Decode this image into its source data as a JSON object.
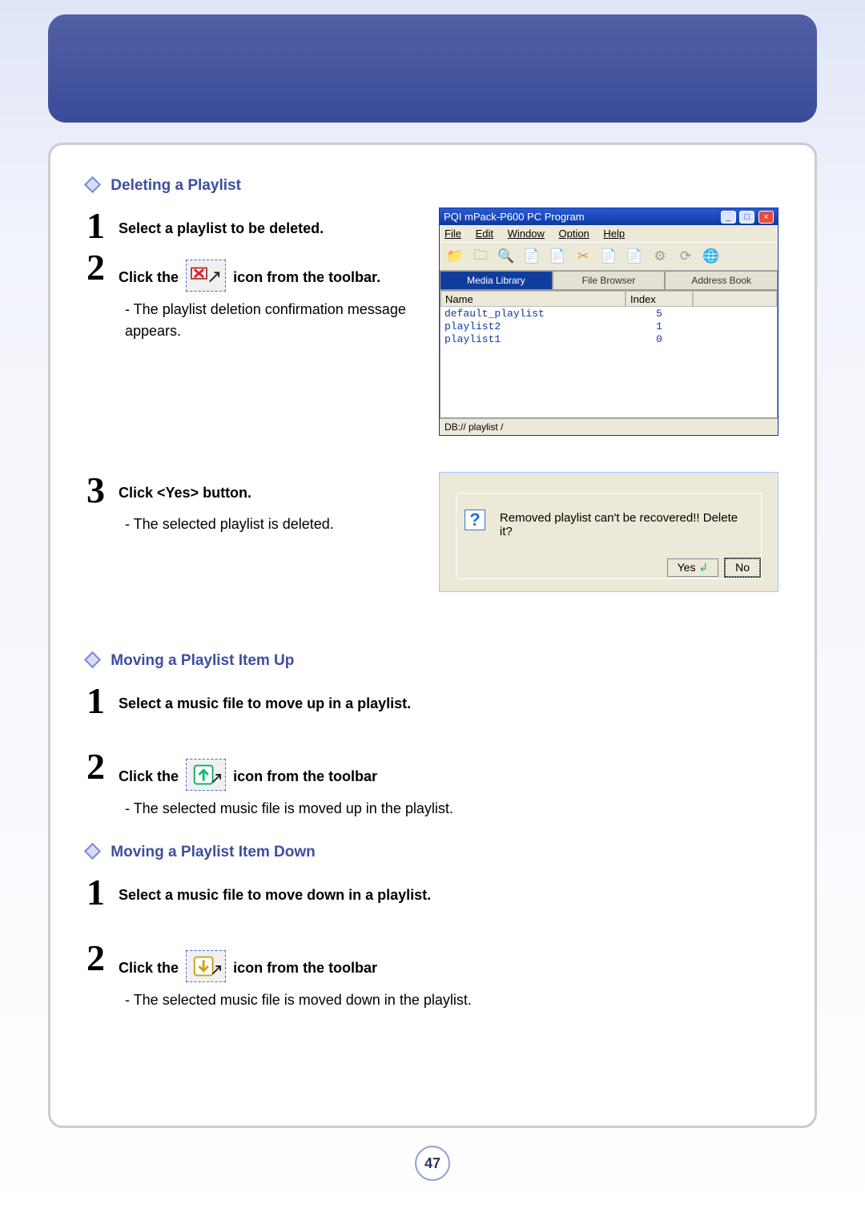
{
  "page_number": "47",
  "sections": {
    "delete": {
      "title": "Deleting a Playlist",
      "step1": "Select a playlist to be deleted.",
      "step2_pre": "Click the",
      "step2_post": "icon from the toolbar.",
      "step2_sub": "- The playlist deletion confirmation message appears.",
      "step3": "Click <Yes> button.",
      "step3_sub": "- The selected playlist is deleted."
    },
    "move_up": {
      "title": "Moving a Playlist Item Up",
      "step1": "Select a music file to move up in a playlist.",
      "step2_pre": "Click the",
      "step2_post": "icon from the toolbar",
      "step2_sub": "- The selected music file is moved up in the playlist."
    },
    "move_down": {
      "title": "Moving a Playlist Item Down",
      "step1": "Select a music file to move down in a playlist.",
      "step2_pre": "Click the",
      "step2_post": "icon from the toolbar",
      "step2_sub": "- The selected music file is moved down in the playlist."
    }
  },
  "app": {
    "title": "PQI mPack-P600 PC Program",
    "menus": {
      "file": "File",
      "edit": "Edit",
      "window": "Window",
      "option": "Option",
      "help": "Help"
    },
    "tabs": {
      "media": "Media Library",
      "file": "File Browser",
      "address": "Address Book"
    },
    "columns": {
      "name": "Name",
      "index": "Index"
    },
    "rows": [
      {
        "name": "default_playlist",
        "index": "5"
      },
      {
        "name": "playlist2",
        "index": "1"
      },
      {
        "name": "playlist1",
        "index": "0"
      }
    ],
    "status": "DB:// playlist /"
  },
  "dialog": {
    "message": "Removed playlist can't be recovered!! Delete it?",
    "yes": "Yes",
    "no": "No"
  }
}
